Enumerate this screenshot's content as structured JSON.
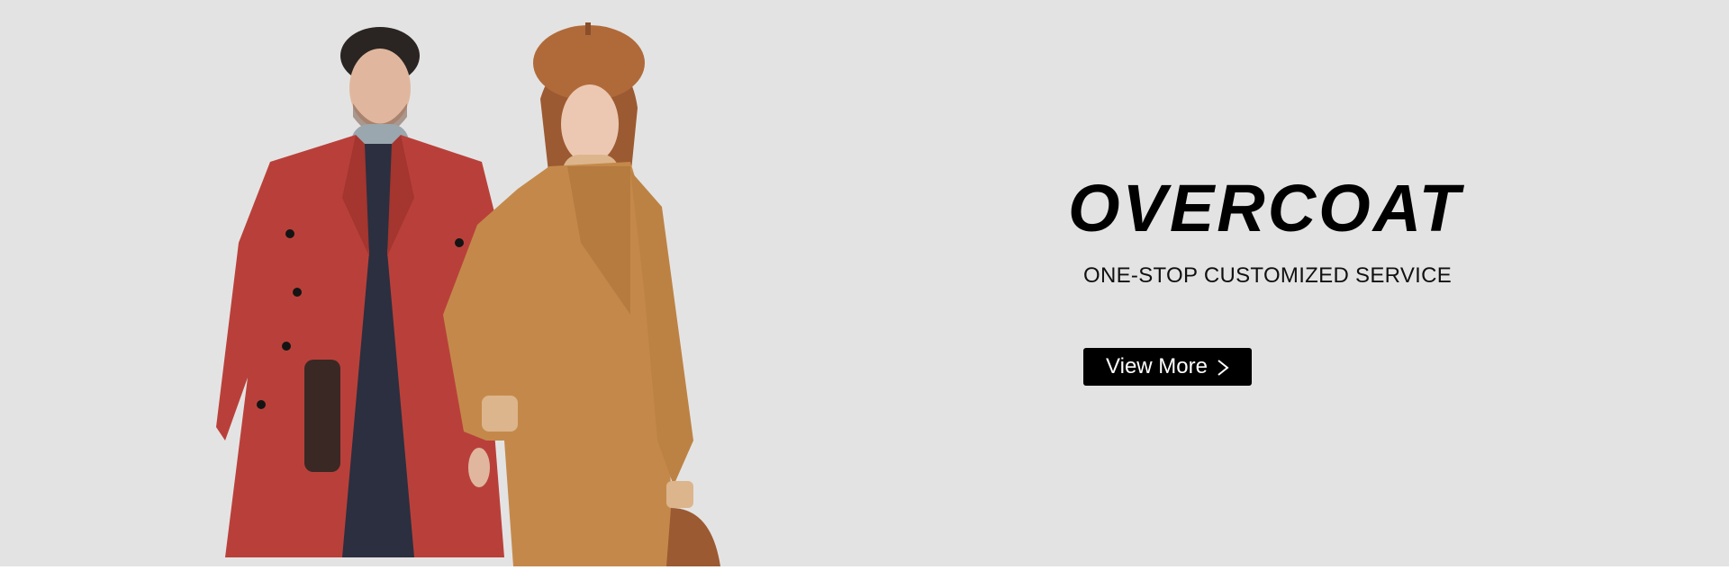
{
  "banner": {
    "title": "OVERCOAT",
    "subtitle": "ONE-STOP CUSTOMIZED SERVICE",
    "cta_label": "View More",
    "cta_icon": "chevron-right-icon",
    "background_color": "#e4e3e3",
    "cta_color": "#000000"
  },
  "models": {
    "man_coat_color": "#b9403a",
    "woman_coat_color": "#c4894a"
  }
}
